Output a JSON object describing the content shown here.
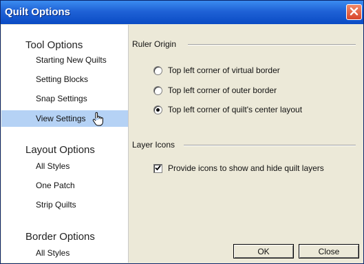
{
  "window": {
    "title": "Quilt Options"
  },
  "sidebar": {
    "groups": [
      {
        "header": "Tool Options",
        "items": [
          "Starting New Quilts",
          "Setting Blocks",
          "Snap Settings",
          "View Settings"
        ]
      },
      {
        "header": "Layout Options",
        "items": [
          "All Styles",
          "One Patch",
          "Strip Quilts"
        ]
      },
      {
        "header": "Border Options",
        "items": [
          "All Styles"
        ]
      }
    ],
    "selected_item": "View Settings"
  },
  "ruler_origin": {
    "title": "Ruler Origin",
    "options": [
      {
        "label": "Top left corner of virtual border",
        "selected": false
      },
      {
        "label": "Top left corner of outer border",
        "selected": false
      },
      {
        "label": "Top left corner of quilt's center layout",
        "selected": true
      }
    ]
  },
  "layer_icons": {
    "title": "Layer Icons",
    "option": {
      "label": "Provide icons to show and hide quilt layers",
      "checked": true
    }
  },
  "buttons": {
    "ok": "OK",
    "close": "Close"
  },
  "icons": {
    "close": "close-icon",
    "cursor": "hand-cursor-icon",
    "check": "check-icon"
  }
}
